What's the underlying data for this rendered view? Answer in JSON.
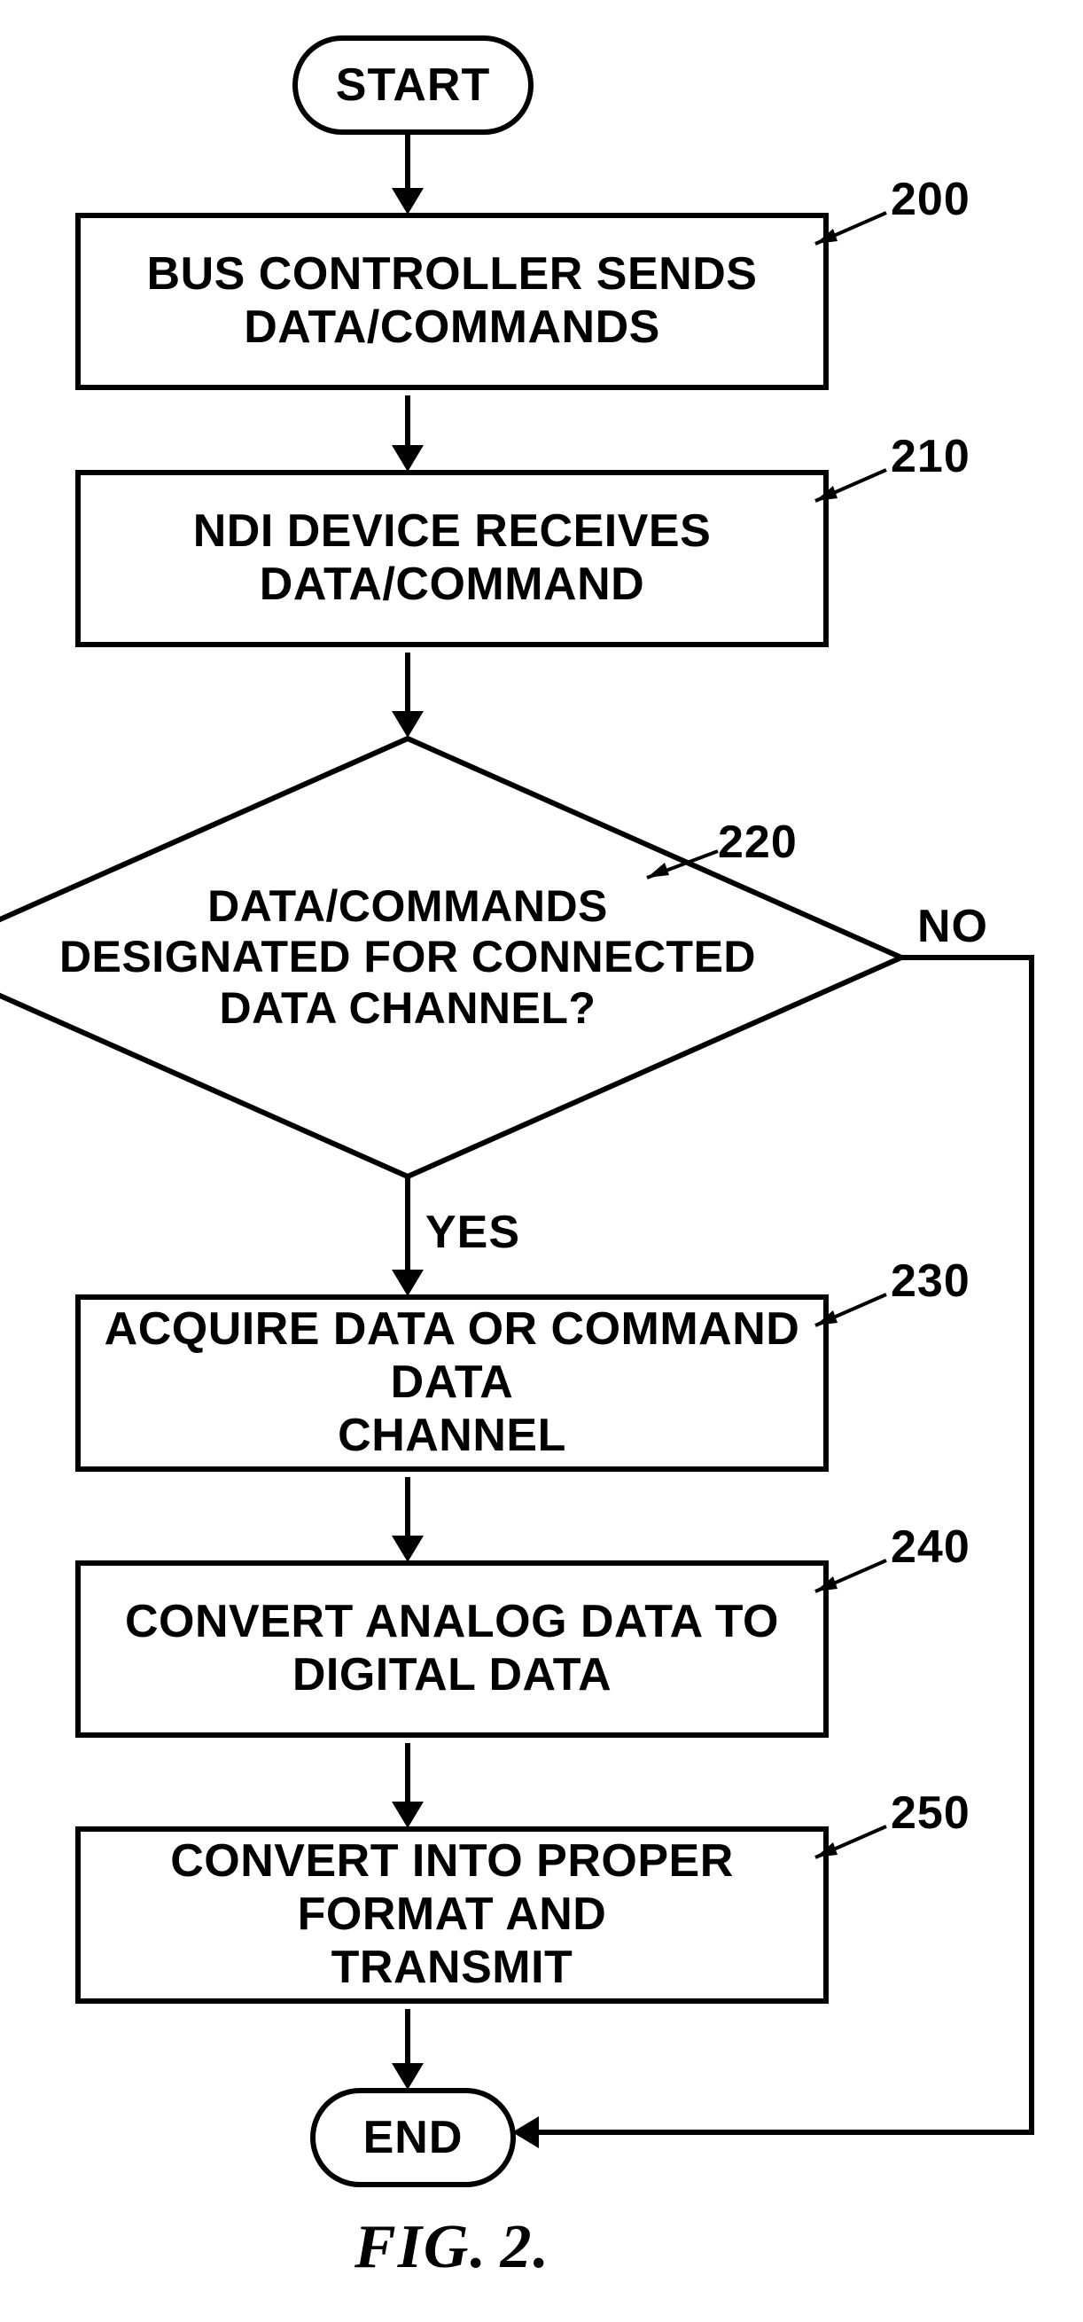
{
  "chart_data": {
    "type": "flowchart",
    "nodes": [
      {
        "id": "start",
        "kind": "terminator",
        "label": "START"
      },
      {
        "id": "n200",
        "kind": "process",
        "ref": "200",
        "lines": [
          "BUS CONTROLLER SENDS",
          "DATA/COMMANDS"
        ]
      },
      {
        "id": "n210",
        "kind": "process",
        "ref": "210",
        "lines": [
          "NDI DEVICE RECEIVES",
          "DATA/COMMAND"
        ]
      },
      {
        "id": "n220",
        "kind": "decision",
        "ref": "220",
        "lines": [
          "DATA/COMMANDS",
          "DESIGNATED FOR CONNECTED",
          "DATA CHANNEL?"
        ]
      },
      {
        "id": "n230",
        "kind": "process",
        "ref": "230",
        "lines": [
          "ACQUIRE DATA OR COMMAND DATA",
          "CHANNEL"
        ]
      },
      {
        "id": "n240",
        "kind": "process",
        "ref": "240",
        "lines": [
          "CONVERT ANALOG DATA TO",
          "DIGITAL DATA"
        ]
      },
      {
        "id": "n250",
        "kind": "process",
        "ref": "250",
        "lines": [
          "CONVERT INTO PROPER FORMAT AND",
          "TRANSMIT"
        ]
      },
      {
        "id": "end",
        "kind": "terminator",
        "label": "END"
      }
    ],
    "edges": [
      {
        "from": "start",
        "to": "n200"
      },
      {
        "from": "n200",
        "to": "n210"
      },
      {
        "from": "n210",
        "to": "n220"
      },
      {
        "from": "n220",
        "to": "n230",
        "label": "YES"
      },
      {
        "from": "n220",
        "to": "end",
        "label": "NO"
      },
      {
        "from": "n230",
        "to": "n240"
      },
      {
        "from": "n240",
        "to": "n250"
      },
      {
        "from": "n250",
        "to": "end"
      }
    ]
  },
  "labels": {
    "yes": "YES",
    "no": "NO",
    "figure_prefix": "FIG.",
    "figure_number": "2."
  },
  "refs": {
    "n200": "200",
    "n210": "210",
    "n220": "220",
    "n230": "230",
    "n240": "240",
    "n250": "250"
  },
  "text": {
    "start": "START",
    "end": "END",
    "n200_l1": "BUS CONTROLLER SENDS",
    "n200_l2": "DATA/COMMANDS",
    "n210_l1": "NDI DEVICE RECEIVES",
    "n210_l2": "DATA/COMMAND",
    "n220_l1": "DATA/COMMANDS",
    "n220_l2": "DESIGNATED FOR CONNECTED",
    "n220_l3": "DATA CHANNEL?",
    "n230_l1": "ACQUIRE DATA OR COMMAND DATA",
    "n230_l2": "CHANNEL",
    "n240_l1": "CONVERT ANALOG DATA TO",
    "n240_l2": "DIGITAL DATA",
    "n250_l1": "CONVERT INTO PROPER FORMAT AND",
    "n250_l2": "TRANSMIT"
  }
}
